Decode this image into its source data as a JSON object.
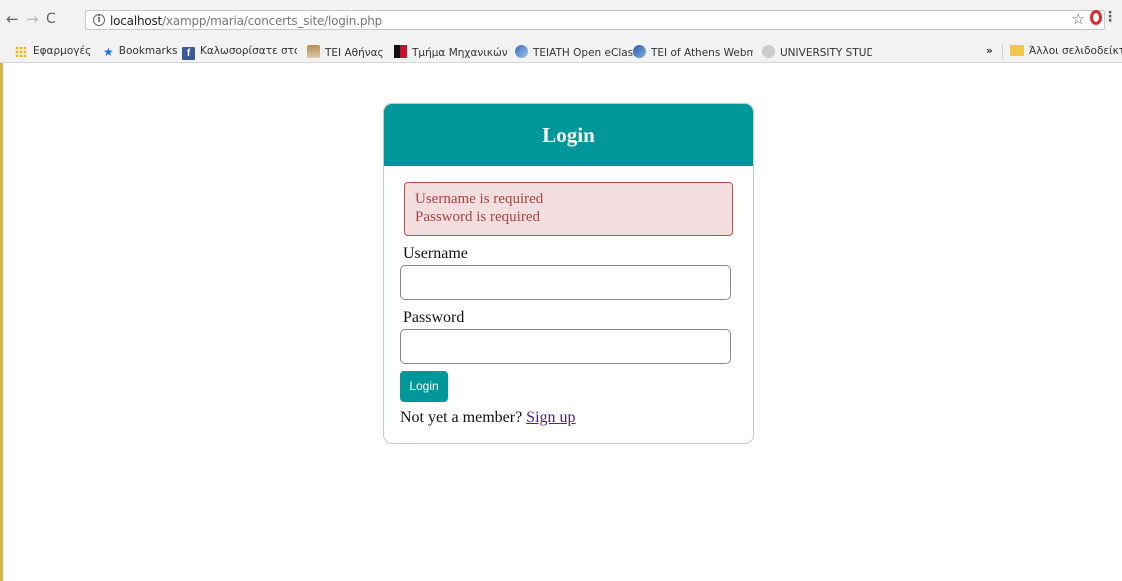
{
  "browser": {
    "url_host": "localhost",
    "url_path": "/xampp/maria/concerts_site/login.php",
    "info_glyph": "i",
    "bookmarks": [
      {
        "label": "Εφαρμογές",
        "icon": "apps-grid-icon"
      },
      {
        "label": "Bookmarks",
        "icon": "star-icon"
      },
      {
        "label": "Καλωσορίσατε στο",
        "icon": "facebook-icon"
      },
      {
        "label": "TEI Αθήνας",
        "icon": "tei-logo-icon"
      },
      {
        "label": "Τμήμα Μηχανικών",
        "icon": "department-flag-icon"
      },
      {
        "label": "TEIATH Open eClass",
        "icon": "eclass-icon"
      },
      {
        "label": "TEI of Athens Webm",
        "icon": "webmail-icon"
      },
      {
        "label": "UNIVERSITY STUDEN",
        "icon": "university-icon"
      }
    ],
    "more_bookmarks": "»",
    "other_bookmarks": "Άλλοι σελιδοδείκτες"
  },
  "login": {
    "title": "Login",
    "errors": [
      "Username is required",
      "Password is required"
    ],
    "username_label": "Username",
    "username_value": "",
    "password_label": "Password",
    "password_value": "",
    "button_label": "Login",
    "member_prompt": "Not yet a member?",
    "signup_link": "Sign up"
  },
  "colors": {
    "header_teal": "#00979a",
    "error_bg": "#f2dede",
    "error_text": "#a94442",
    "link_visited": "#551a8b"
  }
}
